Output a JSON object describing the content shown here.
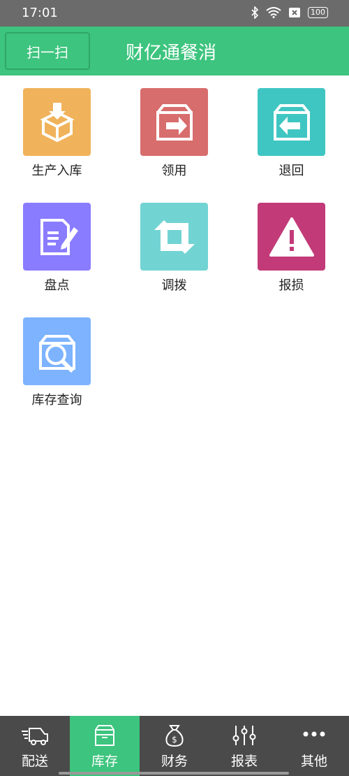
{
  "status": {
    "time": "17:01",
    "battery": "100"
  },
  "header": {
    "scan_button": "扫一扫",
    "title": "财亿通餐消"
  },
  "grid": [
    {
      "label": "生产入库",
      "color": "#f0b25a",
      "icon": "box-download-icon"
    },
    {
      "label": "领用",
      "color": "#d86d6d",
      "icon": "box-arrow-right-icon"
    },
    {
      "label": "退回",
      "color": "#3fc6c2",
      "icon": "box-arrow-left-icon"
    },
    {
      "label": "盘点",
      "color": "#8a7cff",
      "icon": "document-edit-icon"
    },
    {
      "label": "调拨",
      "color": "#72d3d3",
      "icon": "transfer-arrows-icon"
    },
    {
      "label": "报损",
      "color": "#c23b78",
      "icon": "warning-icon"
    },
    {
      "label": "库存查询",
      "color": "#7db3ff",
      "icon": "box-search-icon"
    }
  ],
  "tabs": [
    {
      "label": "配送",
      "icon": "delivery-truck-icon",
      "active": false
    },
    {
      "label": "库存",
      "icon": "inventory-box-icon",
      "active": true
    },
    {
      "label": "财务",
      "icon": "money-bag-icon",
      "active": false
    },
    {
      "label": "报表",
      "icon": "sliders-icon",
      "active": false
    },
    {
      "label": "其他",
      "icon": "more-icon",
      "active": false
    }
  ],
  "colors": {
    "primary": "#3dc47e",
    "tabbar": "#4a4a4a",
    "statusbar": "#6b6b6b"
  }
}
